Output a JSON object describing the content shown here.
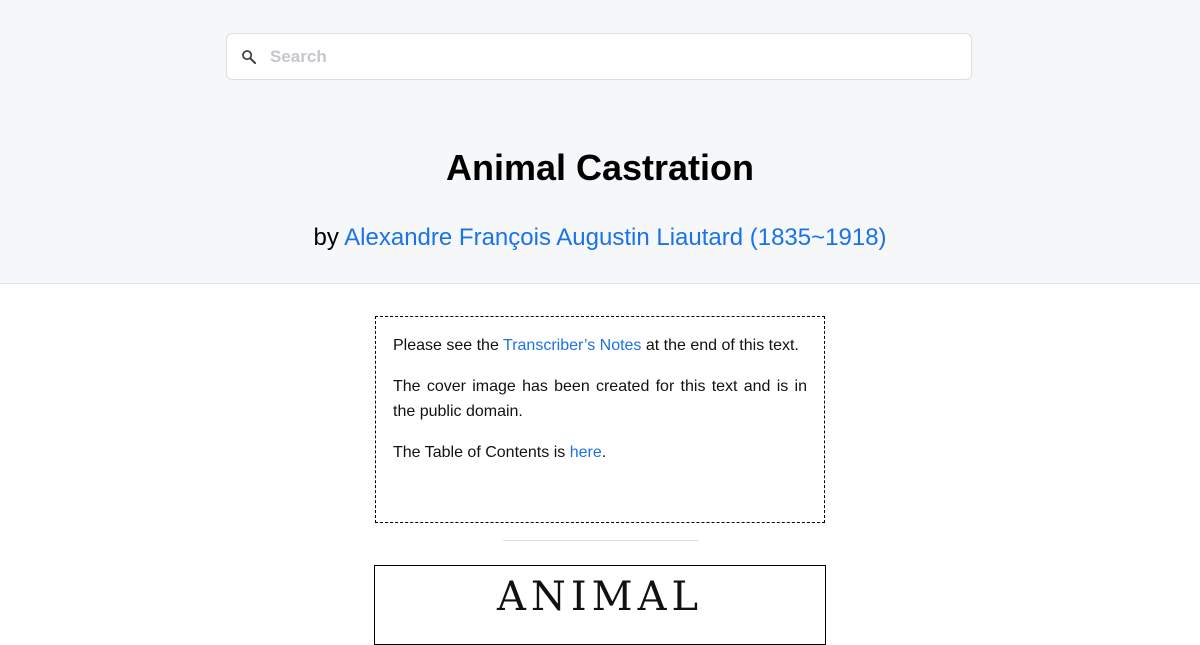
{
  "search": {
    "placeholder": "Search",
    "value": ""
  },
  "book": {
    "title": "Animal Castration",
    "by_prefix": "by",
    "author_link": "Alexandre François Augustin Liautard (1835~1918)"
  },
  "notes": {
    "p1_before": "Please see the ",
    "p1_link": "Transcriber’s Notes",
    "p1_after": " at the end of this text.",
    "p2": "The cover image has been created for this text and is in the public domain.",
    "p3_before": "The Table of Contents is ",
    "p3_link": "here",
    "p3_after": "."
  },
  "cover": {
    "text": "ANIMAL"
  },
  "colors": {
    "link": "#1a73e8",
    "header_bg": "#f6f7f9"
  }
}
